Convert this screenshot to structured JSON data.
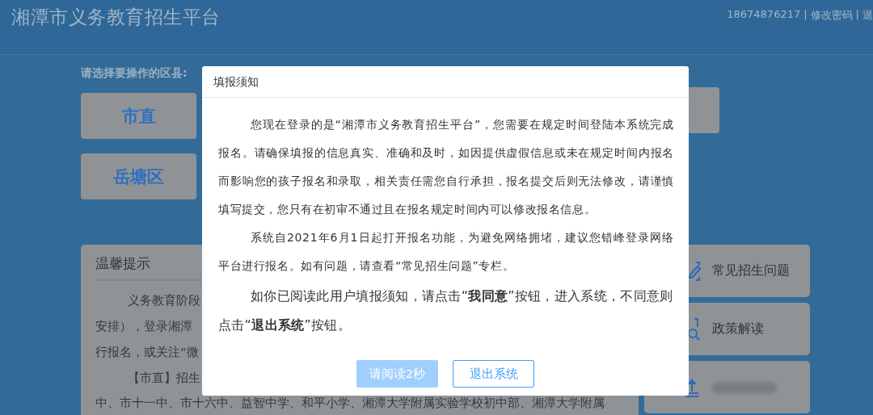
{
  "header": {
    "title": "湘潭市义务教育招生平台",
    "account": "18674876217",
    "separator": "|",
    "links": [
      {
        "label": "修改密码"
      },
      {
        "label": "退"
      }
    ]
  },
  "district_prompt": "请选择要操作的区县:",
  "districts": [
    {
      "label": "市直"
    },
    {
      "label": "岳塘区"
    }
  ],
  "tips": {
    "title": "温馨提示",
    "paragraphs": [
      {
        "lines": [
          "义务教育阶段",
          "安排），登录湘潭",
          "行报名，或关注“微"
        ]
      },
      {
        "lines": [
          "【市直】招生",
          "中、市十一中、市十六中、益智中学、和平小学、湘潭大学附属实验学校初中部、湘潭大学附属"
        ]
      }
    ]
  },
  "side_items": [
    {
      "kind": "edit",
      "label": "常见招生问题",
      "blurred": false
    },
    {
      "kind": "search",
      "label": "政策解读",
      "blurred": false
    },
    {
      "kind": "tray",
      "blurred": true
    }
  ],
  "dialog": {
    "title": "填报须知",
    "paragraphs": [
      {
        "kind": "normal",
        "text": "您现在登录的是“湘潭市义务教育招生平台”，您需要在规定时间登陆本系统完成报名。请确保填报的信息真实、准确和及时，如因提供虚假信息或未在规定时间内报名而影响您的孩子报名和录取，相关责任需您自行承担，报名提交后则无法修改，请谨慎填写提交，您只有在初审不通过且在报名规定时间内可以修改报名信息。"
      },
      {
        "kind": "normal",
        "text": "系统自2021年6月1日起打开报名功能，为避免网络拥堵，建议您错峰登录网络平台进行报名。如有问题，请查看“常见招生问题”专栏。"
      },
      {
        "kind": "large",
        "text": "如你已阅读此用户填报须知，请点击“**我同意**”按钮，进入系统，不同意则点击“**退出系统**”按钮。"
      }
    ],
    "buttons": [
      {
        "label": "请阅读2秒",
        "kind": "primary",
        "disabled": true
      },
      {
        "label": "退出系统",
        "kind": "outline",
        "disabled": false
      }
    ]
  }
}
